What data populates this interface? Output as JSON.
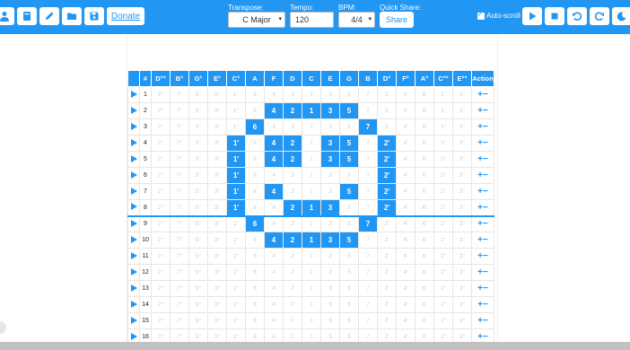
{
  "toolbar": {
    "donate_label": "Donate",
    "transpose_label": "Transpose:",
    "transpose_value": "C Major",
    "tempo_label": "Tempo:",
    "tempo_value": "120",
    "bpm_label": "BPM:",
    "bpm_value": "4/4",
    "quick_share_label": "Quick Share:",
    "share_label": "Share",
    "autoscroll_label": "Auto-scroll",
    "autoscroll_checked": true,
    "accent": "#2196f3"
  },
  "table": {
    "headers": [
      "#",
      "D°°",
      "B°",
      "G°",
      "E°",
      "C°",
      "A",
      "F",
      "D",
      "C",
      "E",
      "G",
      "B",
      "D°",
      "F°",
      "A°",
      "C°°",
      "E°°",
      "Action"
    ],
    "rows": [
      {
        "n": "1",
        "cells": [
          "2°",
          "7°",
          "5°",
          "3°",
          "1°",
          "6",
          "4",
          "2",
          "1",
          "3",
          "5",
          "7",
          "2'",
          "4'",
          "6'",
          "1''",
          "3''"
        ],
        "on": []
      },
      {
        "n": "2",
        "cells": [
          "2°",
          "7°",
          "5°",
          "3°",
          "1°",
          "6",
          "4",
          "2",
          "1",
          "3",
          "5",
          "7",
          "2'",
          "4'",
          "6'",
          "1''",
          "3''"
        ],
        "on": [
          6,
          7,
          8,
          9,
          10
        ]
      },
      {
        "n": "3",
        "cells": [
          "2°",
          "7°",
          "5°",
          "3°",
          "1°",
          "6",
          "4",
          "2",
          "1",
          "3",
          "5",
          "7",
          "2'",
          "4'",
          "6'",
          "1''",
          "3''"
        ],
        "on": [
          5,
          11
        ]
      },
      {
        "n": "4",
        "cells": [
          "2°",
          "7°",
          "5°",
          "3°",
          "1'",
          "6",
          "4",
          "2",
          "1",
          "3",
          "5",
          "7",
          "2'",
          "4'",
          "6'",
          "1''",
          "3''"
        ],
        "on": [
          4,
          6,
          7,
          9,
          10,
          12
        ]
      },
      {
        "n": "5",
        "cells": [
          "2°",
          "7°",
          "5°",
          "3°",
          "1'",
          "6",
          "4",
          "2",
          "1",
          "3",
          "5",
          "7",
          "2'",
          "4'",
          "6'",
          "1''",
          "3''"
        ],
        "on": [
          4,
          6,
          7,
          9,
          10,
          12
        ]
      },
      {
        "n": "6",
        "cells": [
          "2°",
          "7°",
          "5°",
          "3°",
          "1'",
          "6",
          "4",
          "2",
          "1",
          "3",
          "5",
          "7",
          "2'",
          "4'",
          "6'",
          "1''",
          "3''"
        ],
        "on": [
          4,
          12
        ]
      },
      {
        "n": "7",
        "cells": [
          "2°",
          "7°",
          "5°",
          "3°",
          "1'",
          "6",
          "4",
          "2",
          "1",
          "3",
          "5",
          "7",
          "2'",
          "4'",
          "6'",
          "1''",
          "3''"
        ],
        "on": [
          4,
          6,
          10,
          12
        ]
      },
      {
        "n": "8",
        "cells": [
          "2°",
          "7°",
          "5°",
          "3°",
          "1'",
          "6",
          "4",
          "2",
          "1",
          "3",
          "5",
          "7",
          "2'",
          "4'",
          "6'",
          "1''",
          "3''"
        ],
        "on": [
          4,
          7,
          8,
          9,
          12
        ]
      },
      {
        "n": "9",
        "cells": [
          "2°",
          "7°",
          "5°",
          "3°",
          "1°",
          "6",
          "4",
          "2",
          "1",
          "3",
          "5",
          "7",
          "2'",
          "4'",
          "6'",
          "1''",
          "3''"
        ],
        "on": [
          5,
          11
        ]
      },
      {
        "n": "10",
        "cells": [
          "2°",
          "7°",
          "5°",
          "3°",
          "1°",
          "6",
          "4",
          "2",
          "1",
          "3",
          "5",
          "7",
          "2'",
          "4'",
          "6'",
          "1''",
          "3''"
        ],
        "on": [
          6,
          7,
          8,
          9,
          10
        ]
      },
      {
        "n": "11",
        "cells": [
          "2°",
          "7°",
          "5°",
          "3°",
          "1°",
          "6",
          "4",
          "2",
          "1",
          "3",
          "5",
          "7",
          "2'",
          "4'",
          "6'",
          "1''",
          "3''"
        ],
        "on": []
      },
      {
        "n": "12",
        "cells": [
          "2°",
          "7°",
          "5°",
          "3°",
          "1°",
          "6",
          "4",
          "2",
          "1",
          "3",
          "5",
          "7",
          "2'",
          "4'",
          "6'",
          "1''",
          "3''"
        ],
        "on": []
      },
      {
        "n": "13",
        "cells": [
          "2°",
          "7°",
          "5°",
          "3°",
          "1°",
          "6",
          "4",
          "2",
          "1",
          "3",
          "5",
          "7",
          "2'",
          "4'",
          "6'",
          "1''",
          "3''"
        ],
        "on": []
      },
      {
        "n": "14",
        "cells": [
          "2°",
          "7°",
          "5°",
          "3°",
          "1°",
          "6",
          "4",
          "2",
          "1",
          "3",
          "5",
          "7",
          "2'",
          "4'",
          "6'",
          "1''",
          "3''"
        ],
        "on": []
      },
      {
        "n": "15",
        "cells": [
          "2°",
          "7°",
          "5°",
          "3°",
          "1°",
          "6",
          "4",
          "2",
          "1",
          "3",
          "5",
          "7",
          "2'",
          "4'",
          "6'",
          "1''",
          "3''"
        ],
        "on": []
      },
      {
        "n": "16",
        "cells": [
          "2°",
          "7°",
          "5°",
          "3°",
          "1°",
          "6",
          "4",
          "2",
          "1",
          "3",
          "5",
          "7",
          "2'",
          "4'",
          "6'",
          "1''",
          "3''"
        ],
        "on": []
      }
    ],
    "add_symbol": "+",
    "remove_symbol": "−"
  },
  "icons": [
    "user-icon",
    "book-icon",
    "pencil-icon",
    "folder-icon",
    "save-icon",
    "play-icon",
    "stop-icon",
    "undo-icon",
    "redo-icon",
    "dark-mode-icon"
  ]
}
